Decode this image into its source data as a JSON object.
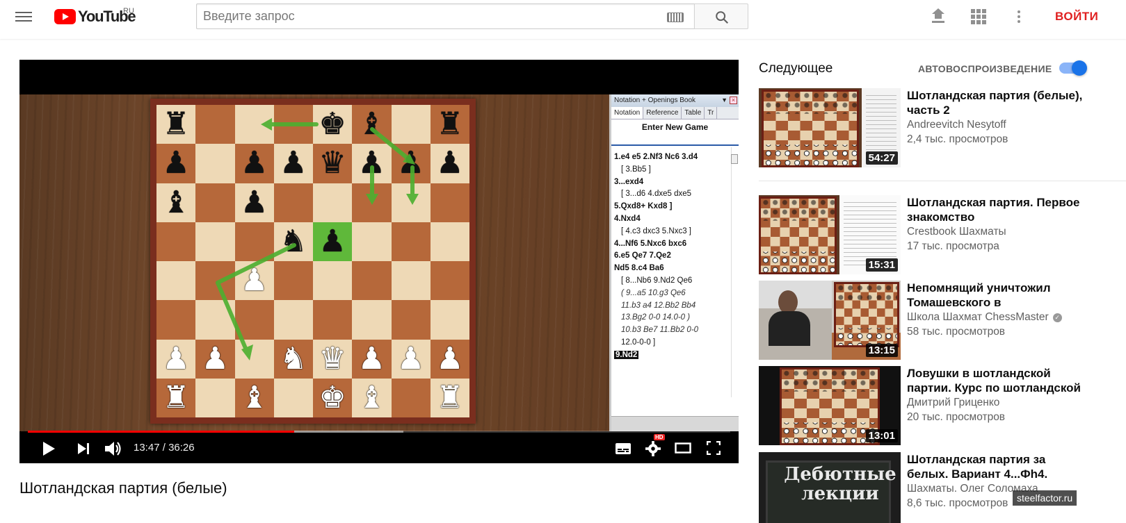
{
  "masthead": {
    "logo_text": "YouTube",
    "region": "RU",
    "search_placeholder": "Введите запрос",
    "signin_label": "ВОЙТИ"
  },
  "player": {
    "time_current": "13:47",
    "time_separator": "/",
    "time_total": "36:26",
    "progress_fraction": 0.379,
    "buffered_fraction": 0.535,
    "hd_badge": "HD",
    "notation": {
      "title": "Notation + Openings Book",
      "tabs": [
        "Notation",
        "Reference",
        "Table",
        "Tr"
      ],
      "new_game": "Enter New Game",
      "lines": [
        "1.e4  e5  2.Nf3  Nc6  3.d4",
        "[ 3.Bb5 ]",
        "3...exd4",
        "[ 3...d6  4.dxe5  dxe5",
        "5.Qxd8+  Kxd8 ]",
        "4.Nxd4",
        "[ 4.c3  dxc3  5.Nxc3 ]",
        "4...Nf6     5.Nxc6  bxc6",
        "6.e5     Qe7     7.Qe2",
        "Nd5  8.c4  Ba6",
        "[ 8...Nb6  9.Nd2     Qe6",
        "( 9...a5  10.g3     Qe6",
        "11.b3  a4  12.Bb2     Bb4",
        "13.Bg2  0-0  14.0-0     )",
        "10.b3     Be7  11.Bb2  0-0",
        "12.0-0-0     ]",
        "9.Nd2"
      ]
    },
    "board": [
      "r...kb.r",
      "p.ppqppp",
      "b.p.....",
      "...np...",
      "..P.....",
      "........",
      "PP.NQPPP",
      "R.B.KB.R"
    ],
    "highlight_square": "e5"
  },
  "video_title": "Шотландская партия (белые)",
  "sidebar": {
    "up_next": "Следующее",
    "autoplay_label": "АВТОВОСПРОИЗВЕДЕНИЕ",
    "autoplay_on": true,
    "cards": [
      {
        "title": "Шотландская партия (белые), часть 2",
        "channel": "Andreevitch Nesytoff",
        "views": "2,4 тыс. просмотров",
        "duration": "54:27"
      },
      {
        "title": "Шотландская партия. Первое знакомство",
        "channel": "Crestbook Шахматы",
        "views": "17 тыс. просмотра",
        "duration": "15:31"
      },
      {
        "title": "Непомнящий уничтожил Томашевского в",
        "channel": "Школа Шахмат ChessMaster",
        "views": "58 тыс. просмотров",
        "duration": "13:15",
        "verified": true
      },
      {
        "title": "Ловушки в шотландской партии. Курс по шотландской",
        "channel": "Дмитрий Гриценко",
        "views": "20 тыс. просмотров",
        "duration": "13:01"
      },
      {
        "title": "Шотландская партия за белых. Вариант 4...Фh4.",
        "channel": "Шахматы. Олег Соломаха",
        "views": "8,6 тыс. просмотров",
        "thumb_text": "Дебютные лекции"
      }
    ]
  },
  "watermark": "steelfactor.ru",
  "colors": {
    "brand_red": "#ff0000",
    "signin_red": "#e02020",
    "toggle_blue": "#1a73e8",
    "highlight_green": "#5fb83a"
  }
}
